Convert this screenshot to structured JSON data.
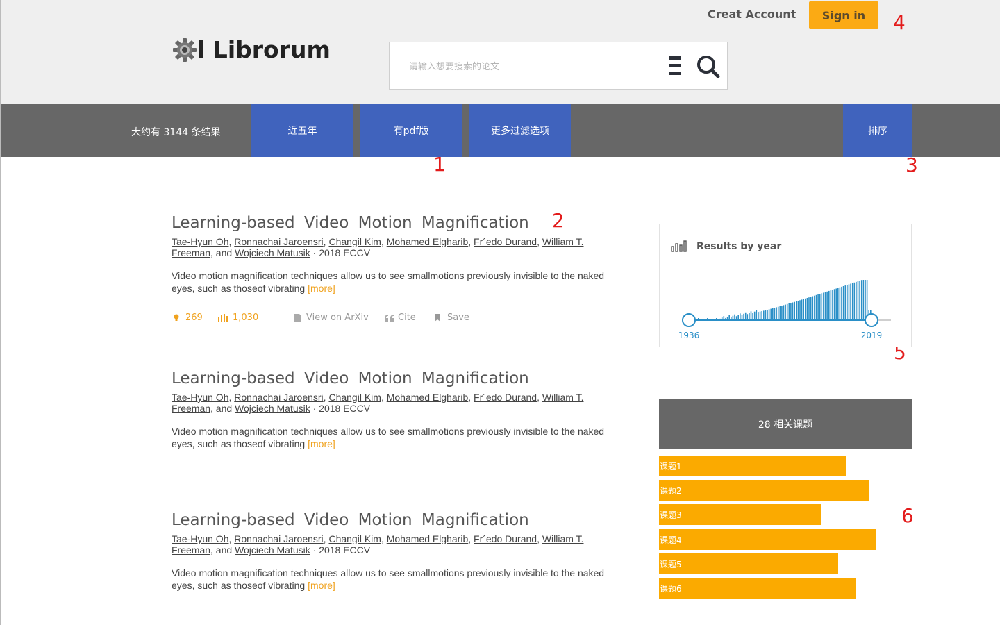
{
  "header": {
    "logo_text": "l Librorum",
    "search_placeholder": "请输入想要搜索的论文",
    "creat_account_label": "Creat Account",
    "sign_in_label": "Sign in"
  },
  "navbar": {
    "result_count": "大约有 3144 条结果",
    "filters": [
      "近五年",
      "有pdf版",
      "更多过滤选项"
    ],
    "sort_label": "排序"
  },
  "markers": [
    "1",
    "2",
    "3",
    "4",
    "5",
    "6"
  ],
  "results": [
    {
      "title": "Learning-based Video Motion Magnification",
      "authors": [
        "Tae-Hyun Oh",
        "Ronnachai Jaroensri",
        "Changil Kim",
        "Mohamed Elgharib",
        "Fr´edo Durand",
        "William T. Freeman",
        "Wojciech Matusik"
      ],
      "venue": "2018 ECCV",
      "abstract": "Video motion magnification techniques allow us to see smallmotions previously invisible to the naked eyes, such as thoseof vibrating",
      "more_label": "[more]",
      "citations": "269",
      "views": "1,030",
      "view_on_arxiv_label": "View on ArXiv",
      "cite_label": "Cite",
      "save_label": "Save"
    },
    {
      "title": "Learning-based Video Motion Magnification",
      "authors": [
        "Tae-Hyun Oh",
        "Ronnachai Jaroensri",
        "Changil Kim",
        "Mohamed Elgharib",
        "Fr´edo Durand",
        "William T. Freeman",
        "Wojciech Matusik"
      ],
      "venue": "2018 ECCV",
      "abstract": "Video motion magnification techniques allow us to see smallmotions previously invisible to the naked eyes, such as thoseof vibrating",
      "more_label": "[more]"
    },
    {
      "title": "Learning-based Video Motion Magnification",
      "authors": [
        "Tae-Hyun Oh",
        "Ronnachai Jaroensri",
        "Changil Kim",
        "Mohamed Elgharib",
        "Fr´edo Durand",
        "William T. Freeman",
        "Wojciech Matusik"
      ],
      "venue": "2018 ECCV",
      "abstract": "Video motion magnification techniques allow us to see smallmotions previously invisible to the naked eyes, such as thoseof vibrating",
      "more_label": "[more]"
    }
  ],
  "results_by_year": {
    "title": "Results by year",
    "start_year": "1936",
    "end_year": "2019",
    "bar_color": "#2a8fc7"
  },
  "topics": {
    "header": "28 相关课题",
    "items": [
      {
        "label": "课题1",
        "level": 0.74
      },
      {
        "label": "课题2",
        "level": 0.83
      },
      {
        "label": "课题3",
        "level": 0.64
      },
      {
        "label": "课题4",
        "level": 0.86
      },
      {
        "label": "课题5",
        "level": 0.71
      },
      {
        "label": "课题6",
        "level": 0.78
      }
    ],
    "bar_color": "#fbaa00"
  },
  "colors": {
    "accent_blue": "#4063bd",
    "nav_grey": "#676767",
    "orange": "#fbaa14"
  }
}
